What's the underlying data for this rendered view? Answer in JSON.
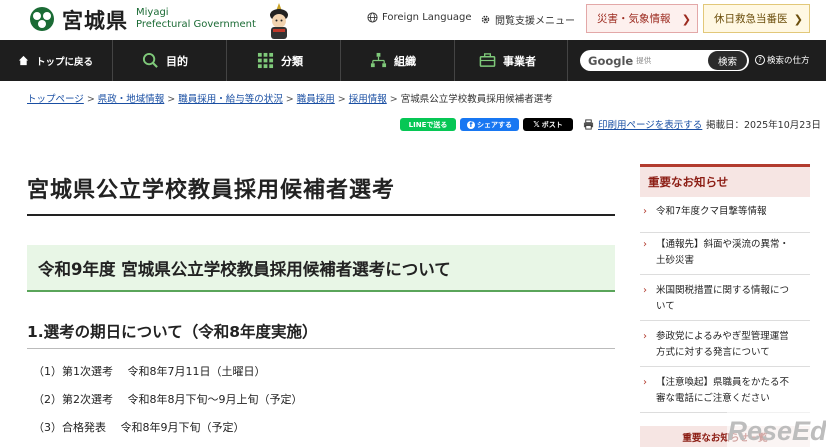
{
  "header": {
    "logo_text": "宮城県",
    "logo_en_line1": "Miyagi",
    "logo_en_line2": "Prefectural Government",
    "foreign_language": "Foreign Language",
    "accessibility_menu": "閲覧支援メニュー",
    "disaster_button": "災害・気象情報",
    "holiday_doctor_button": "休日救急当番医"
  },
  "nav": {
    "back_to_top": "トップに戻る",
    "items": [
      {
        "label": "目的",
        "icon": "search-icon"
      },
      {
        "label": "分類",
        "icon": "grid-icon"
      },
      {
        "label": "組織",
        "icon": "org-chart-icon"
      },
      {
        "label": "事業者",
        "icon": "briefcase-icon"
      }
    ],
    "search_brand": "Google",
    "search_brand_sub": "提供",
    "search_button": "検索",
    "search_help": "検索の仕方"
  },
  "breadcrumb": {
    "links": [
      "トップページ",
      "県政・地域情報",
      "職員採用・給与等の状況",
      "職員採用",
      "採用情報"
    ],
    "current": "宮城県公立学校教員採用候補者選考"
  },
  "share": {
    "line": "LINEで送る",
    "facebook": "シェアする",
    "x": "ポスト",
    "print": "印刷用ページを表示する",
    "posted_date": "掲載日：2025年10月23日"
  },
  "main": {
    "title": "宮城県公立学校教員採用候補者選考",
    "h2": "令和9年度 宮城県公立学校教員採用候補者選考について",
    "h3": "1.選考の期日について（令和8年度実施）",
    "items": [
      "（1）第1次選考　 令和8年7月11日（土曜日）",
      "（2）第2次選考　 令和8年8月下旬～9月上旬（予定）",
      "（3）合格発表　 令和8年9月下旬（予定）"
    ]
  },
  "sidebar": {
    "heading": "重要なお知らせ",
    "items": [
      {
        "line1": "令和7年度クマ目撃等情報",
        "line2": ""
      },
      {
        "line1": "【通報先】斜面や渓流の異常・",
        "line2": "土砂災害"
      },
      {
        "line1": "米国関税措置に関する情報につ",
        "line2": "いて"
      },
      {
        "line1": "参政党によるみやぎ型管理運営",
        "line2": "方式に対する発言について"
      },
      {
        "line1": "【注意喚起】県職員をかたる不",
        "line2": "審な電話にご注意ください"
      }
    ],
    "bottom_link": "重要なお知らせ一覧"
  },
  "watermark": {
    "text": "ReseEd"
  },
  "colors": {
    "nav_bg": "#1e1e1e",
    "accent_red": "#b23b2e",
    "h2_bg": "#e8f6e6",
    "link_blue": "#1a4fa3"
  }
}
